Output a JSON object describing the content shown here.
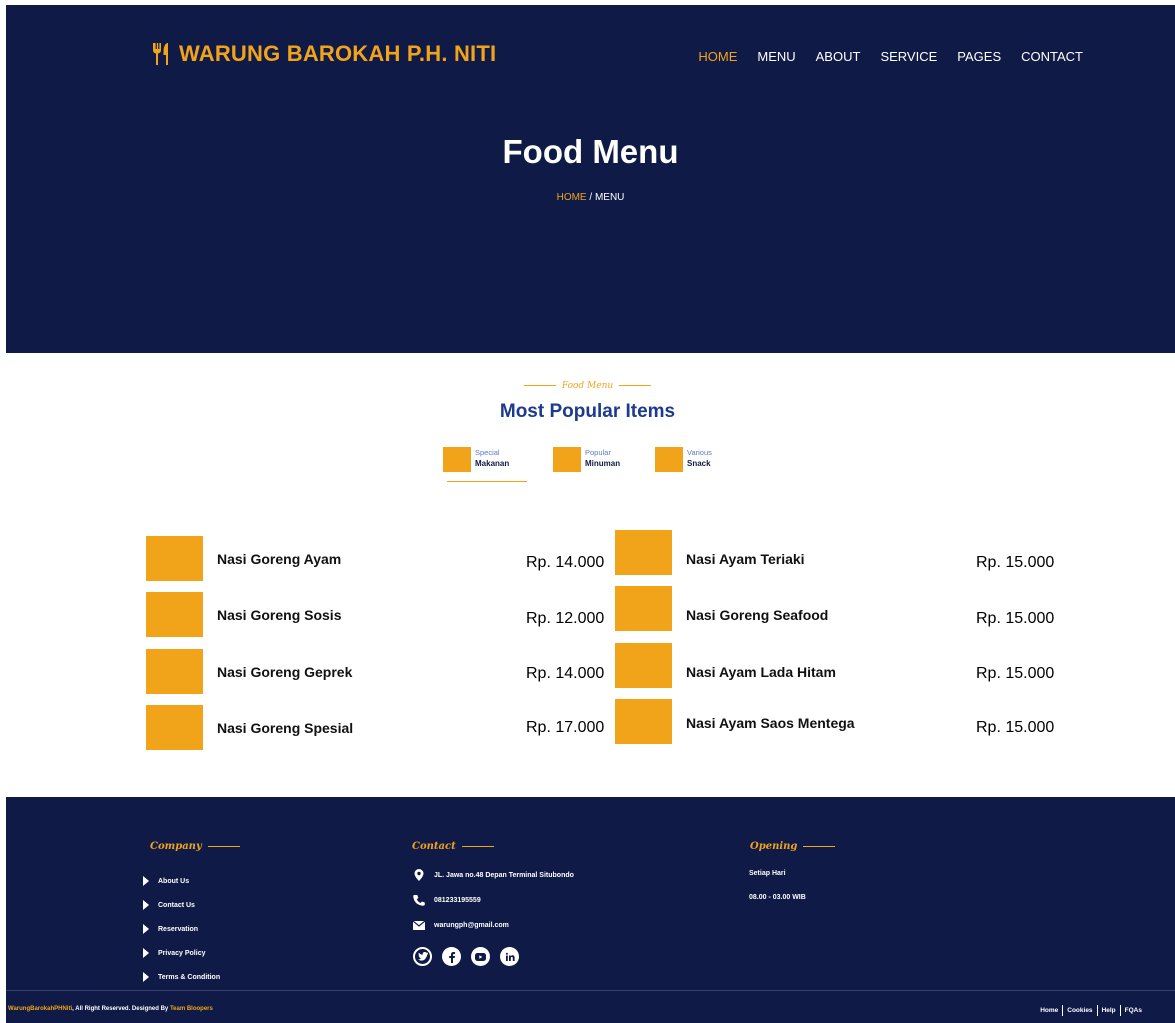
{
  "header": {
    "brand": "WARUNG BAROKAH P.H. NITI",
    "nav": [
      {
        "label": "HOME",
        "active": true
      },
      {
        "label": "MENU",
        "active": false
      },
      {
        "label": "ABOUT",
        "active": false
      },
      {
        "label": "SERVICE",
        "active": false
      },
      {
        "label": "PAGES",
        "active": false
      },
      {
        "label": "CONTACT",
        "active": false
      }
    ],
    "title": "Food Menu",
    "breadcrumb": {
      "home": "HOME",
      "separator": " / ",
      "current": "MENU"
    }
  },
  "menu": {
    "tag": "Food Menu",
    "title": "Most Popular Items",
    "tabs": [
      {
        "small": "Special",
        "big": "Makanan"
      },
      {
        "small": "Popular",
        "big": "Minuman"
      },
      {
        "small": "Various",
        "big": "Snack"
      }
    ],
    "items_left": [
      {
        "name": "Nasi Goreng Ayam",
        "price": "Rp. 14.000"
      },
      {
        "name": "Nasi Goreng Sosis",
        "price": "Rp. 12.000"
      },
      {
        "name": "Nasi Goreng Geprek",
        "price": "Rp. 14.000"
      },
      {
        "name": "Nasi Goreng Spesial",
        "price": "Rp. 17.000"
      }
    ],
    "items_right": [
      {
        "name": "Nasi Ayam Teriaki",
        "price": "Rp. 15.000"
      },
      {
        "name": "Nasi Goreng Seafood",
        "price": "Rp. 15.000"
      },
      {
        "name": "Nasi Ayam Lada Hitam",
        "price": "Rp. 15.000"
      },
      {
        "name": "Nasi Ayam Saos Mentega",
        "price": "Rp. 15.000"
      }
    ]
  },
  "footer": {
    "company": {
      "heading": "Company",
      "links": [
        "About Us",
        "Contact Us",
        "Reservation",
        "Privacy Policy",
        "Terms & Condition"
      ]
    },
    "contact": {
      "heading": "Contact",
      "address": "JL. Jawa no.48 Depan Terminal Situbondo",
      "phone": "081233195559",
      "email": "warungph@gmail.com"
    },
    "opening": {
      "heading": "Opening",
      "days": "Setiap Hari",
      "hours": "08.00 - 03.00 WIB"
    },
    "copyright": {
      "site": "WarungBarokahPHNiti",
      "text": ", All Right Reserved. Designed By ",
      "designer": "Team Bloopers"
    },
    "bottom_links": [
      "Home",
      "Cookies",
      "Help",
      "FQAs"
    ]
  },
  "colors": {
    "navy": "#0f1b46",
    "accent": "#f1a31a",
    "title_blue": "#1d3a8f"
  },
  "icons": [
    "utensils-icon",
    "map-pin-icon",
    "phone-icon",
    "envelope-icon",
    "twitter-icon",
    "facebook-icon",
    "youtube-icon",
    "linkedin-icon",
    "caret-right-icon"
  ]
}
